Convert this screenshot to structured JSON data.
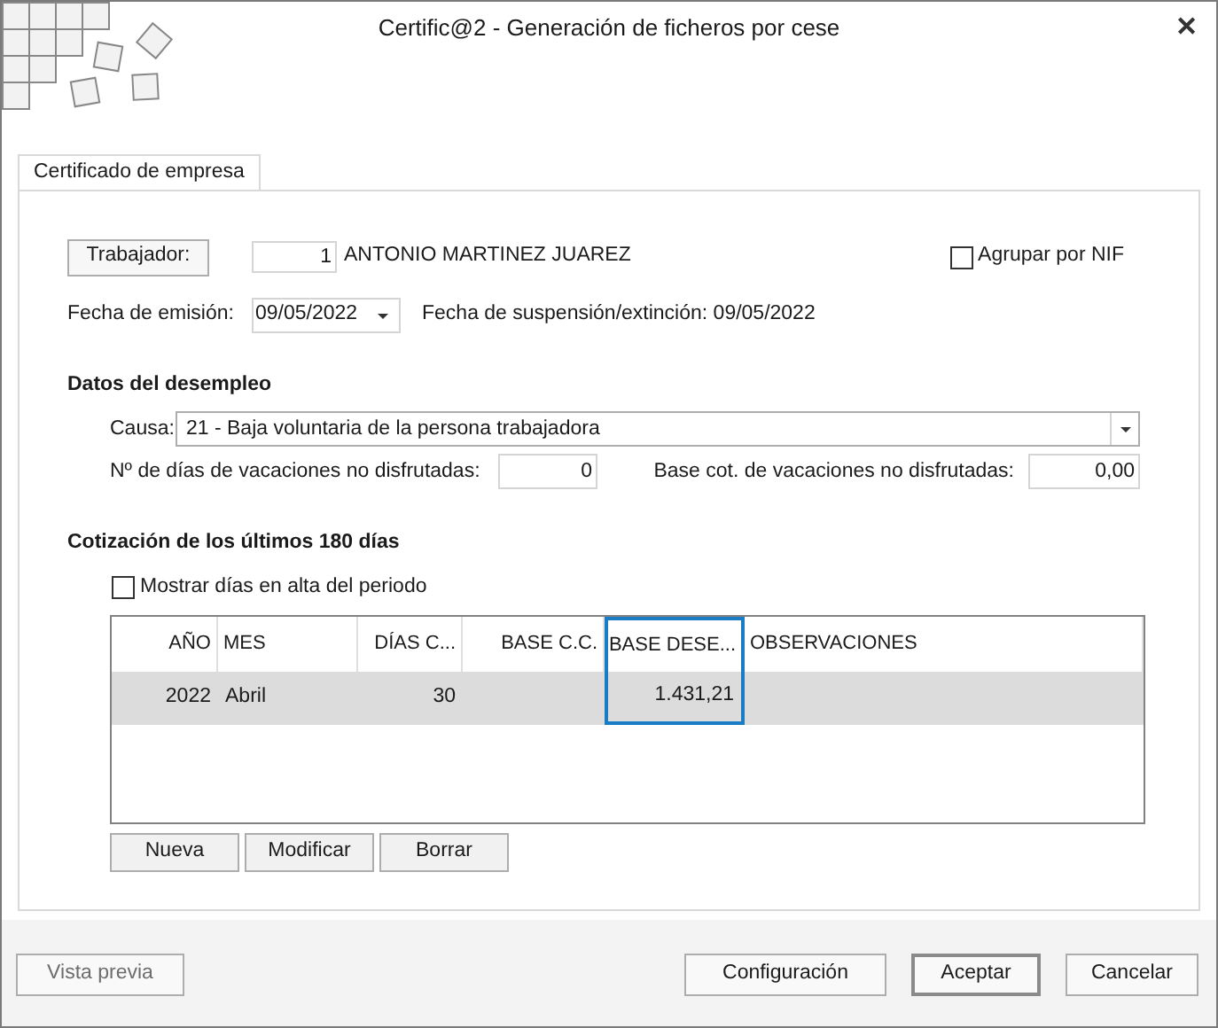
{
  "window": {
    "title": "Certific@2 - Generación de ficheros por cese",
    "close": "✕"
  },
  "tabs": [
    {
      "label": "Certificado de empresa",
      "selected": true
    }
  ],
  "worker": {
    "button": "Trabajador:",
    "number": "1",
    "name": "ANTONIO MARTINEZ JUAREZ"
  },
  "group_by_nif": {
    "label": "Agrupar por NIF",
    "checked": false
  },
  "issue_date": {
    "label": "Fecha de emisión:",
    "value": "09/05/2022"
  },
  "suspension_text": "Fecha de suspensión/extinción: 09/05/2022",
  "unemployment": {
    "title": "Datos del desempleo",
    "cause_label": "Causa:",
    "cause_value": "21 - Baja voluntaria de la persona trabajadora",
    "vacation_days_label": "Nº de días de vacaciones no disfrutadas:",
    "vacation_days": "0",
    "vacation_base_label": "Base cot. de vacaciones no disfrutadas:",
    "vacation_base": "0,00"
  },
  "contributions": {
    "title": "Cotización de los últimos 180 días",
    "show_days": {
      "label": "Mostrar días en alta del periodo",
      "checked": false
    },
    "table": {
      "columns": [
        "AÑO",
        "MES",
        "DÍAS C...",
        "BASE C.C.",
        "BASE DESE...",
        "OBSERVACIONES"
      ],
      "rows": [
        {
          "selected": true,
          "cells": [
            {
              "text": "2022",
              "focused": false
            },
            {
              "text": "Abril",
              "focused": false
            },
            {
              "text": "30",
              "focused": false
            },
            {
              "focused": false
            },
            {
              "text": "1.431,21",
              "focused": true
            },
            {
              "focused": false
            }
          ]
        }
      ]
    },
    "buttons": [
      "Nueva",
      "Modificar",
      "Borrar"
    ]
  },
  "footer_buttons": [
    {
      "label": "Vista previa",
      "disabled": true,
      "default": false
    },
    {
      "label": "Configuración",
      "disabled": false,
      "default": false
    },
    {
      "label": "Aceptar",
      "disabled": false,
      "default": true
    },
    {
      "label": "Cancelar",
      "disabled": false,
      "default": false
    }
  ]
}
